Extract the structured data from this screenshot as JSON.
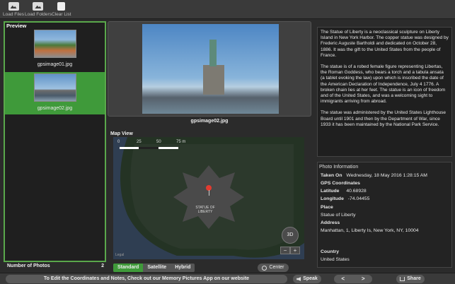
{
  "toolbar": {
    "load_files": "Load Files",
    "load_folders": "Load Folders",
    "clear_list": "Clear List"
  },
  "preview": {
    "title": "Preview",
    "items": [
      {
        "filename": "gpsimage01.jpg",
        "selected": false
      },
      {
        "filename": "gpsimage02.jpg",
        "selected": true
      }
    ],
    "count_label": "Number of Photos",
    "count_value": "2"
  },
  "photo": {
    "caption": "gpsimage02.jpg"
  },
  "map": {
    "title": "Map View",
    "scale_labels": [
      "0",
      "25",
      "50",
      "75 m"
    ],
    "place_label_line1": "STATUE OF",
    "place_label_line2": "LIBERTY",
    "three_d": "3D",
    "zoom_out": "−",
    "zoom_in": "+",
    "legal": "Legal",
    "types": [
      "Standard",
      "Satellite",
      "Hybrid"
    ],
    "active_type": "Standard",
    "center_label": "Center"
  },
  "description": {
    "paragraphs": [
      "The Statue of Liberty is a neoclassical sculpture on Liberty Island in New York Harbor. The copper statue was designed by Frederic Auguste Bartholdi and dedicated on October 28, 1886. It was the gift to the United States from the people of France.",
      "The statue is of a robed female figure representing Libertas, the Roman Goddess, who bears a torch and a tabula ansata (a tablet evoking the law) upon which is inscribed the date of the American Declaration of Independence, July 4 1776. A broken chain lies at her feet. The statue is an icon of freedom and of the United States, and was a welcoming sight to immigrants arriving from abroad.",
      "The statue was administered by the United States Lighthouse Board until 1901 and then by the Department of War, since 1933 it has been maintained by the National Park Service."
    ]
  },
  "info": {
    "title": "Photo Information",
    "taken_on_label": "Taken On",
    "taken_on_value": "Wednesday, 18 May 2016 1:28:15 AM",
    "gps_label": "GPS Coordinates",
    "latitude_label": "Latitude",
    "latitude_value": "40.68928",
    "longitude_label": "Longitude",
    "longitude_value": "-74.04455",
    "place_label": "Place",
    "place_value": "Statue of Liberty",
    "address_label": "Address",
    "address_value": "Manhattan, 1, Liberty Is, New York, NY, 10004",
    "country_label": "Country",
    "country_value": "United States"
  },
  "bottom": {
    "promo": "To Edit the Coordinates and Notes, Check out our Memory Pictures App on our website",
    "speak": "Speak",
    "prev": "<",
    "next": ">",
    "share": "Share"
  },
  "colors": {
    "accent_green": "#3f9a3a",
    "background": "#2b2b2b",
    "pin_red": "#e23b30"
  }
}
